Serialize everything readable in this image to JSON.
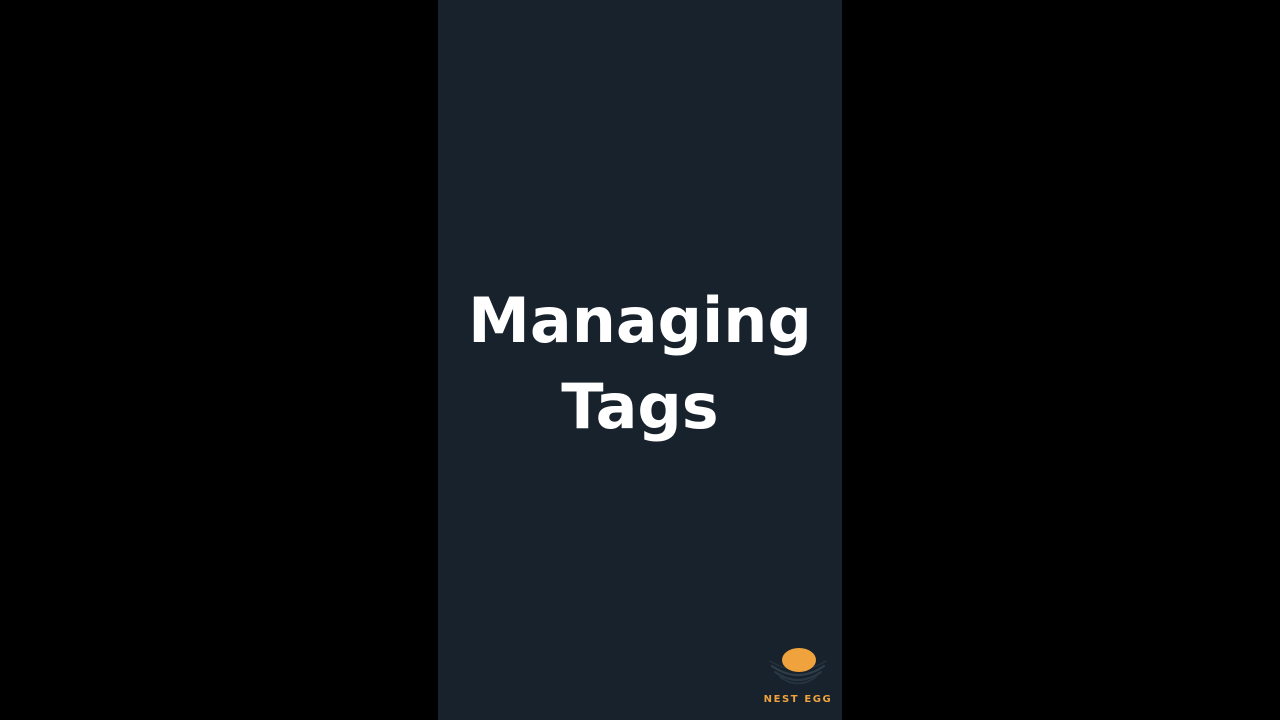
{
  "slide": {
    "title_lines": [
      "Managing",
      "Tags"
    ]
  },
  "brand": {
    "name": "NEST EGG",
    "egg_color": "#f0a23c",
    "nest_color": "#2e3d49"
  },
  "colors": {
    "letterbox": "#000000",
    "frame_background": "#17222c",
    "title_text": "#ffffff"
  }
}
